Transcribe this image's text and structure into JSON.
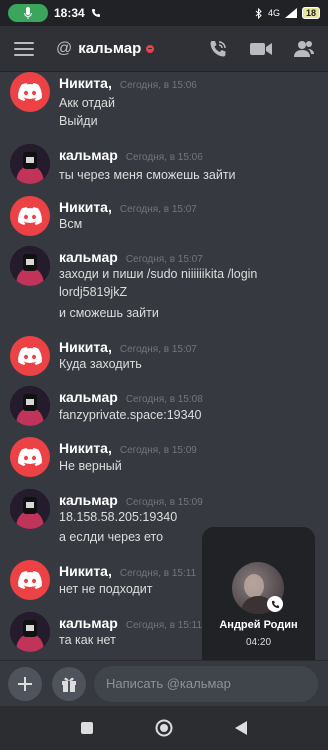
{
  "status_bar": {
    "time": "18:34",
    "network": "4G",
    "battery": "18",
    "icons": [
      "mic-icon",
      "phone-icon",
      "bluetooth-icon",
      "signal-icon",
      "battery-icon"
    ]
  },
  "header": {
    "at_symbol": "@",
    "channel": "кальмар",
    "status_color": "#ed4245",
    "icons": [
      "call-icon",
      "video-icon",
      "members-icon"
    ]
  },
  "messages": [
    {
      "author": "Никита,",
      "time": "Сегодня, в 15:06",
      "lines": [
        "Акк отдай",
        "Выйди"
      ],
      "avatar": "discord-logo-icon"
    },
    {
      "author": "кальмар",
      "time": "Сегодня, в 15:06",
      "lines": [
        "ты через меня сможешь зайти"
      ],
      "avatar": "squid-game-icon"
    },
    {
      "author": "Никита,",
      "time": "Сегодня, в 15:07",
      "lines": [
        "Всм"
      ],
      "avatar": "discord-logo-icon"
    },
    {
      "author": "кальмар",
      "time": "Сегодня, в 15:07",
      "lines": [
        "заходи и пиши /sudo niiiiiikita /login",
        "lordj5819jkZ",
        "и сможешь зайти"
      ],
      "avatar": "squid-game-icon"
    },
    {
      "author": "Никита,",
      "time": "Сегодня, в 15:07",
      "lines": [
        "Куда заходить"
      ],
      "avatar": "discord-logo-icon"
    },
    {
      "author": "кальмар",
      "time": "Сегодня, в 15:08",
      "lines": [
        "fanzyprivate.space:19340"
      ],
      "avatar": "squid-game-icon"
    },
    {
      "author": "Никита,",
      "time": "Сегодня, в 15:09",
      "lines": [
        "Не верный"
      ],
      "avatar": "discord-logo-icon"
    },
    {
      "author": "кальмар",
      "time": "Сегодня, в 15:09",
      "lines": [
        "18.158.58.205:19340",
        "а еслди через ето"
      ],
      "avatar": "squid-game-icon"
    },
    {
      "author": "Никита,",
      "time": "Сегодня, в 15:11",
      "lines": [
        "нет не подходит"
      ],
      "avatar": "discord-logo-icon"
    },
    {
      "author": "кальмар",
      "time": "Сегодня, в 15:11",
      "lines": [
        "та как нет"
      ],
      "avatar": "squid-game-icon"
    }
  ],
  "call_overlay": {
    "name": "Андрей Родин",
    "timer": "04:20"
  },
  "input_bar": {
    "placeholder": "Написать @кальмар"
  },
  "colors": {
    "background": "#36393f",
    "header": "#2f3136",
    "discord_red": "#ed4245",
    "online_green": "#3ba55d"
  }
}
